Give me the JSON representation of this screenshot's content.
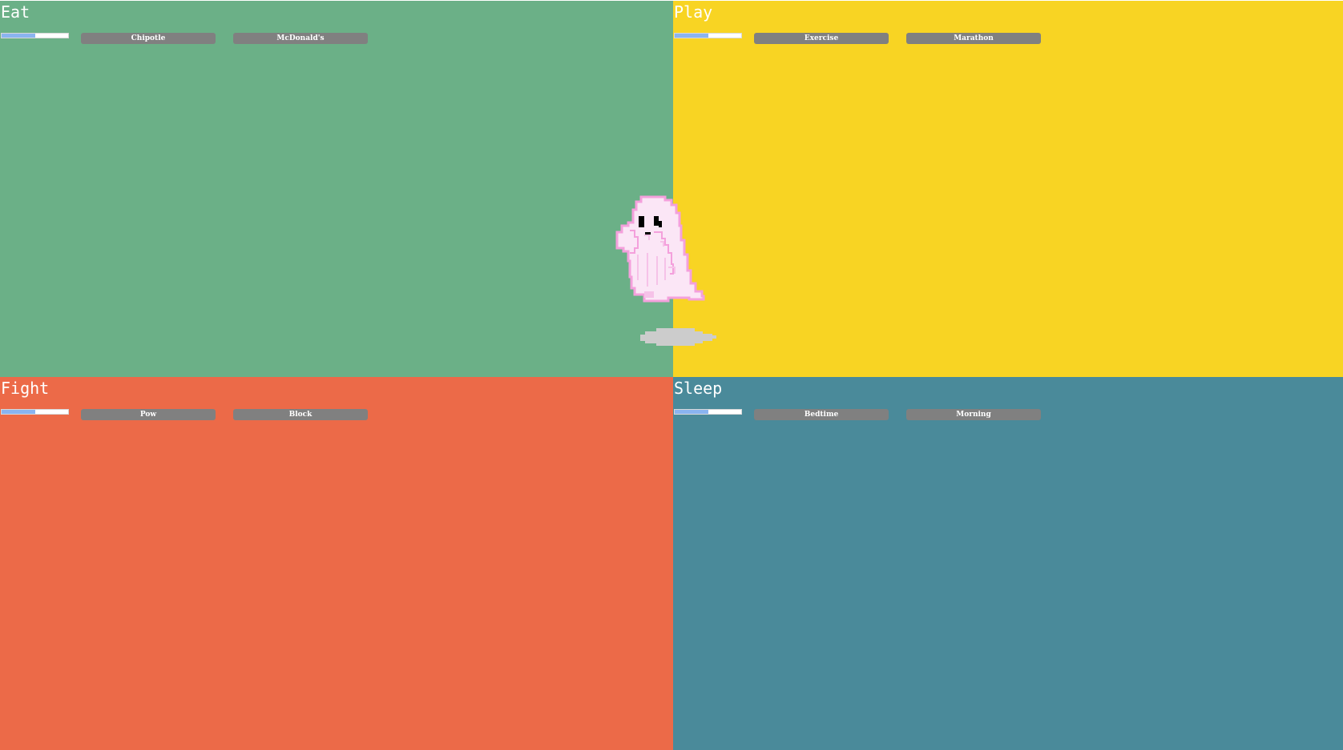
{
  "colors": {
    "eat": "#6bb087",
    "play": "#f8d423",
    "fight": "#ec6a48",
    "sleep": "#4a8a9a",
    "meter_fill": "#8ab4f0",
    "button": "#808080",
    "pet_body": "#fbe6f6",
    "pet_outline": "#f4a0dc",
    "shadow": "#cccccc"
  },
  "quadrants": {
    "eat": {
      "title": "Eat",
      "meter_level": 0.5,
      "buttons": [
        "Chipotle",
        "McDonald's"
      ]
    },
    "play": {
      "title": "Play",
      "meter_level": 0.5,
      "buttons": [
        "Exercise",
        "Marathon"
      ]
    },
    "fight": {
      "title": "Fight",
      "meter_level": 0.5,
      "buttons": [
        "Pow",
        "Block"
      ]
    },
    "sleep": {
      "title": "Sleep",
      "meter_level": 0.5,
      "buttons": [
        "Bedtime",
        "Morning"
      ]
    }
  },
  "pet": {
    "icon": "ghost-pet-icon"
  }
}
